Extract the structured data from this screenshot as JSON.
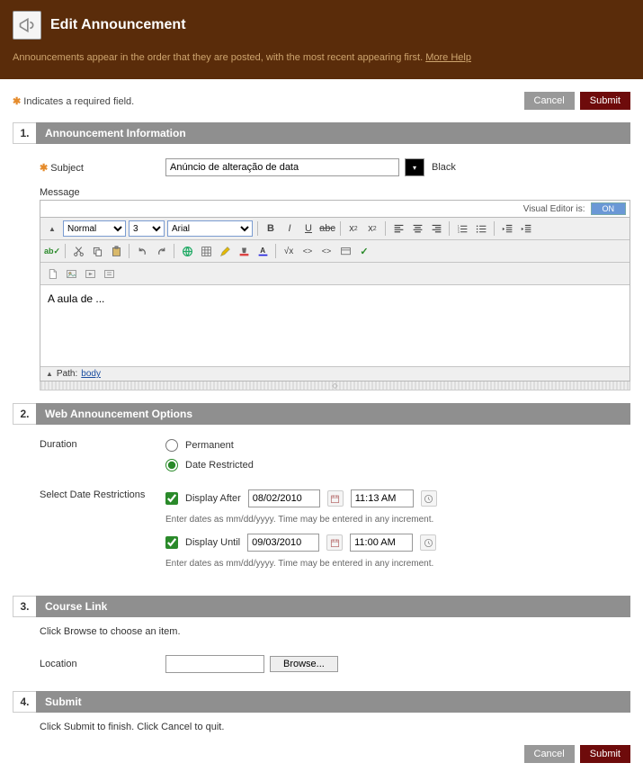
{
  "header": {
    "title": "Edit Announcement",
    "subtext": "Announcements appear in the order that they are posted, with the most recent appearing first.",
    "more_help": "More Help"
  },
  "required_text": "Indicates a required field.",
  "buttons": {
    "cancel": "Cancel",
    "submit": "Submit"
  },
  "section1": {
    "num": "1.",
    "title": "Announcement Information",
    "subject_label": "Subject",
    "subject_value": "Anúncio de alteração de data",
    "color_name": "Black",
    "message_label": "Message",
    "visual_editor_label": "Visual Editor is:",
    "visual_editor_state": "ON",
    "toolbar": {
      "style": "Normal",
      "size": "3",
      "font": "Arial"
    },
    "editor_content": "A aula de ...",
    "path_label": "Path:",
    "path_value": "body"
  },
  "section2": {
    "num": "2.",
    "title": "Web Announcement Options",
    "duration_label": "Duration",
    "permanent": "Permanent",
    "date_restricted": "Date Restricted",
    "select_dates_label": "Select Date Restrictions",
    "display_after": "Display After",
    "display_after_date": "08/02/2010",
    "display_after_time": "11:13 AM",
    "display_until": "Display Until",
    "display_until_date": "09/03/2010",
    "display_until_time": "11:00 AM",
    "helper": "Enter dates as mm/dd/yyyy. Time may be entered in any increment."
  },
  "section3": {
    "num": "3.",
    "title": "Course Link",
    "instruction": "Click Browse to choose an item.",
    "location_label": "Location",
    "location_value": "",
    "browse": "Browse..."
  },
  "section4": {
    "num": "4.",
    "title": "Submit",
    "instruction": "Click Submit to finish. Click Cancel to quit."
  }
}
